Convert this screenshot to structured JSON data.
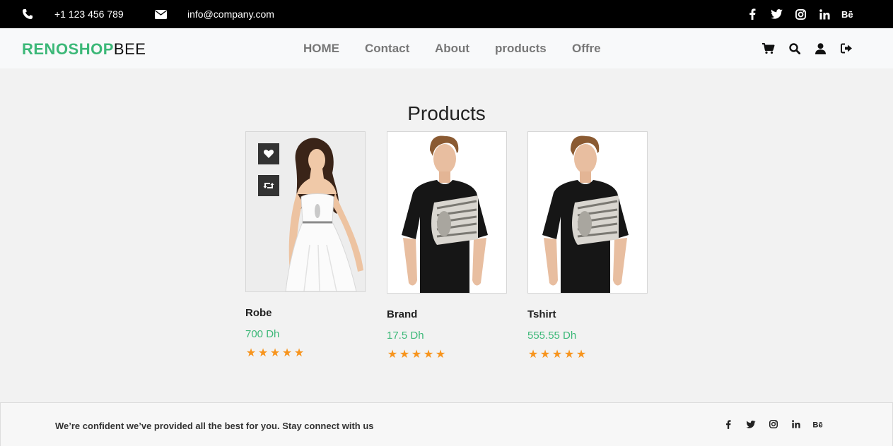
{
  "topbar": {
    "phone": "+1 123 456 789",
    "email": "info@company.com",
    "phone_icon": "phone-icon",
    "email_icon": "envelope-icon",
    "social": [
      "facebook-icon",
      "twitter-icon",
      "instagram-icon",
      "linkedin-icon",
      "behance-icon"
    ]
  },
  "brand": {
    "part1": "RENOSHOP",
    "part2": "BEE",
    "accent": "#3cb878"
  },
  "nav": {
    "links": [
      "HOME",
      "Contact",
      "About",
      "products",
      "Offre"
    ],
    "icons": [
      "cart-icon",
      "search-icon",
      "user-icon",
      "sign-out-icon"
    ]
  },
  "products_section": {
    "title": "Products",
    "items": [
      {
        "name": "Robe",
        "price": "700 Dh",
        "rating": 5
      },
      {
        "name": "Brand",
        "price": "17.5 Dh",
        "rating": 5
      },
      {
        "name": "Tshirt",
        "price": "555.55 Dh",
        "rating": 5
      }
    ]
  },
  "footer": {
    "text": "We’re confident we’ve provided all the best for you. Stay connect with us",
    "social": [
      "facebook-icon",
      "twitter-icon",
      "instagram-icon",
      "linkedin-icon",
      "behance-icon"
    ]
  },
  "colors": {
    "price": "#3cb878",
    "star": "#f7941d",
    "topbar": "#000000"
  }
}
